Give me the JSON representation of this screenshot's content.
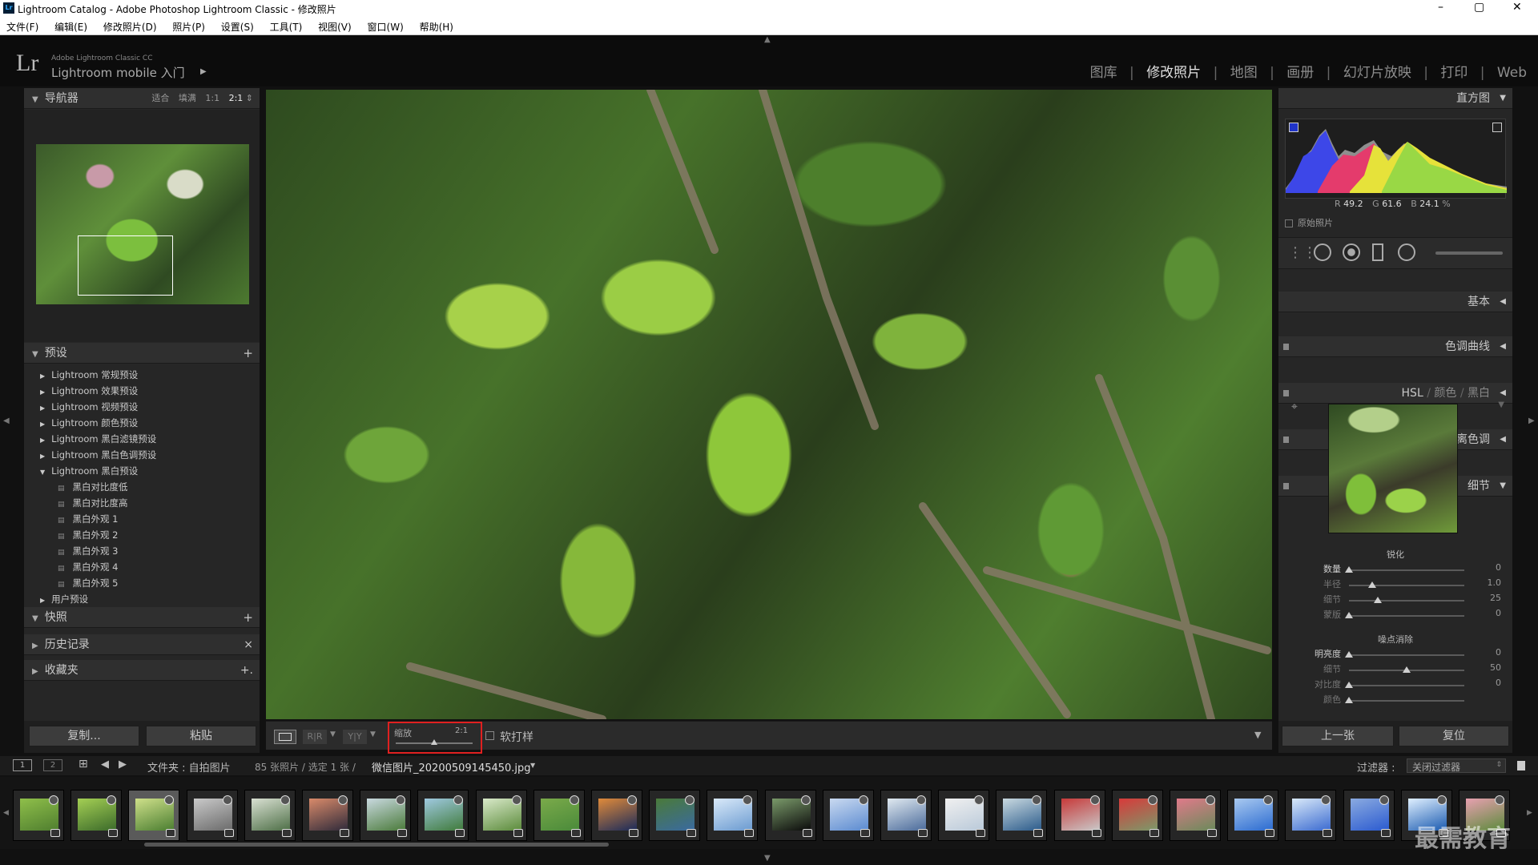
{
  "window": {
    "title": "Lightroom Catalog - Adobe Photoshop Lightroom Classic - 修改照片",
    "controls": [
      "–",
      "▢",
      "✕"
    ]
  },
  "menu": [
    "文件(F)",
    "编辑(E)",
    "修改照片(D)",
    "照片(P)",
    "设置(S)",
    "工具(T)",
    "视图(V)",
    "窗口(W)",
    "帮助(H)"
  ],
  "identity": {
    "logo": "Lr",
    "product": "Adobe Lightroom Classic CC",
    "subtitle": "Lightroom mobile 入门",
    "arrow": "▶"
  },
  "modules": [
    "图库",
    "修改照片",
    "地图",
    "画册",
    "幻灯片放映",
    "打印",
    "Web"
  ],
  "active_module": "修改照片",
  "navigator": {
    "title": "导航器",
    "zoom_options": [
      "适合",
      "填满",
      "1:1",
      "2:1"
    ],
    "selected_zoom": "2:1"
  },
  "presets": {
    "title": "预设",
    "add": "+",
    "groups": [
      "Lightroom 常规预设",
      "Lightroom 效果预设",
      "Lightroom 视频预设",
      "Lightroom 颜色预设",
      "Lightroom 黑白滤镜预设",
      "Lightroom 黑白色调预设",
      "Lightroom 黑白预设"
    ],
    "expanded_items": [
      "黑白对比度低",
      "黑白对比度高",
      "黑白外观 1",
      "黑白外观 2",
      "黑白外观 3",
      "黑白外观 4",
      "黑白外观 5"
    ],
    "user": "用户预设"
  },
  "snapshots": {
    "title": "快照",
    "action": "+"
  },
  "history": {
    "title": "历史记录",
    "action": "×"
  },
  "collections": {
    "title": "收藏夹",
    "action": "+."
  },
  "left_buttons": {
    "copy": "复制...",
    "paste": "粘贴"
  },
  "toolbar": {
    "zoom_label": "缩放",
    "zoom_value": "2:1",
    "zoom_level": 0.5,
    "softproof": "软打样",
    "compare1": "R|R",
    "compare2": "Y|Y"
  },
  "histogram": {
    "title": "直方图",
    "r_label": "R",
    "r": "49.2",
    "g_label": "G",
    "g": "61.6",
    "b_label": "B",
    "b": "24.1",
    "pct": "%",
    "original": "原始照片"
  },
  "right_panels": {
    "basic": "基本",
    "tone": "色调曲线",
    "hsl": "HSL",
    "color": "颜色",
    "bw": "黑白",
    "split": "分离色调",
    "detail": "细节"
  },
  "sharpen": {
    "title": "锐化",
    "rows": [
      {
        "label": "数量",
        "value": "0",
        "pos": 0.0
      },
      {
        "label": "半径",
        "value": "1.0",
        "pos": 0.2
      },
      {
        "label": "细节",
        "value": "25",
        "pos": 0.25
      },
      {
        "label": "蒙版",
        "value": "0",
        "pos": 0.0
      }
    ]
  },
  "noise": {
    "title": "噪点消除",
    "rows": [
      {
        "label": "明亮度",
        "value": "0",
        "pos": 0.0
      },
      {
        "label": "细节",
        "value": "50",
        "pos": 0.5
      },
      {
        "label": "对比度",
        "value": "0",
        "pos": 0.0
      },
      {
        "label": "颜色",
        "value": "",
        "pos": 0.0
      }
    ]
  },
  "right_buttons": {
    "prev": "上一张",
    "reset": "复位"
  },
  "filmstrip_bar": {
    "screen1": "1",
    "screen2": "2",
    "path": "文件夹 : 自拍图片",
    "count": "85 张照片 / 选定 1 张 /",
    "filename": "微信图片_20200509145450.jpg",
    "filter_label": "过滤器 :",
    "filter_value": "关闭过滤器"
  },
  "watermark": "最需教育",
  "colors": {
    "accent_red": "#e02020",
    "panel": "#262626",
    "header": "#2f2f2f"
  }
}
